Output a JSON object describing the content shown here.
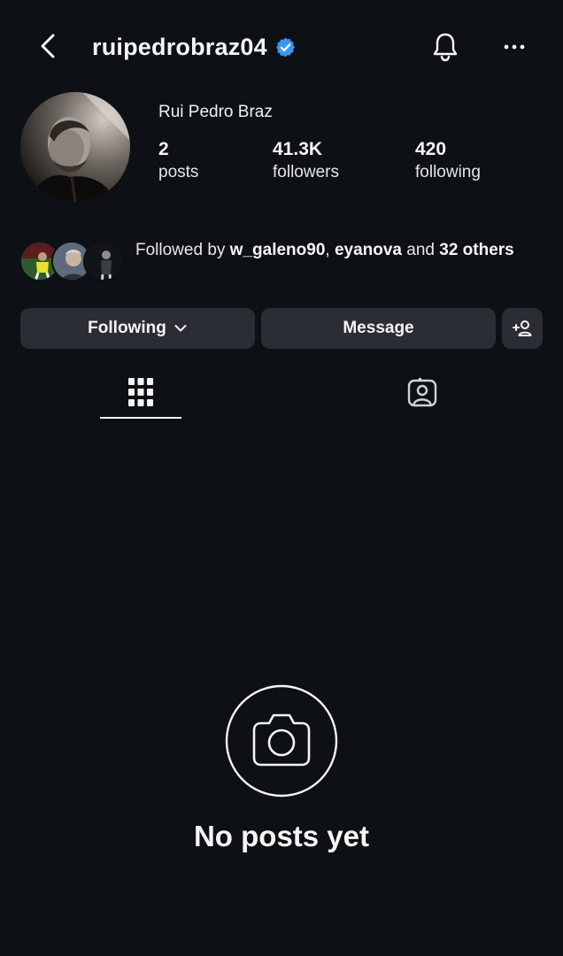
{
  "header": {
    "username": "ruipedrobraz04",
    "verified_color": "#3897f0"
  },
  "profile": {
    "display_name": "Rui Pedro Braz",
    "stats": [
      {
        "value": "2",
        "label": "posts"
      },
      {
        "value": "41.3K",
        "label": "followers"
      },
      {
        "value": "420",
        "label": "following"
      }
    ]
  },
  "followed_by": {
    "prefix": "Followed by ",
    "user1": "w_galeno90",
    "sep": ", ",
    "user2": "eyanova",
    "and": " and ",
    "others": "32 others"
  },
  "actions": {
    "following_label": "Following",
    "message_label": "Message"
  },
  "tabs": [
    {
      "icon": "grid-icon",
      "active": true
    },
    {
      "icon": "tagged-icon",
      "active": false
    }
  ],
  "empty_state": {
    "title": "No posts yet",
    "icon": "camera-icon"
  },
  "colors": {
    "background": "#0d1014",
    "button": "#2a2d33",
    "text": "#f5f5f5"
  }
}
